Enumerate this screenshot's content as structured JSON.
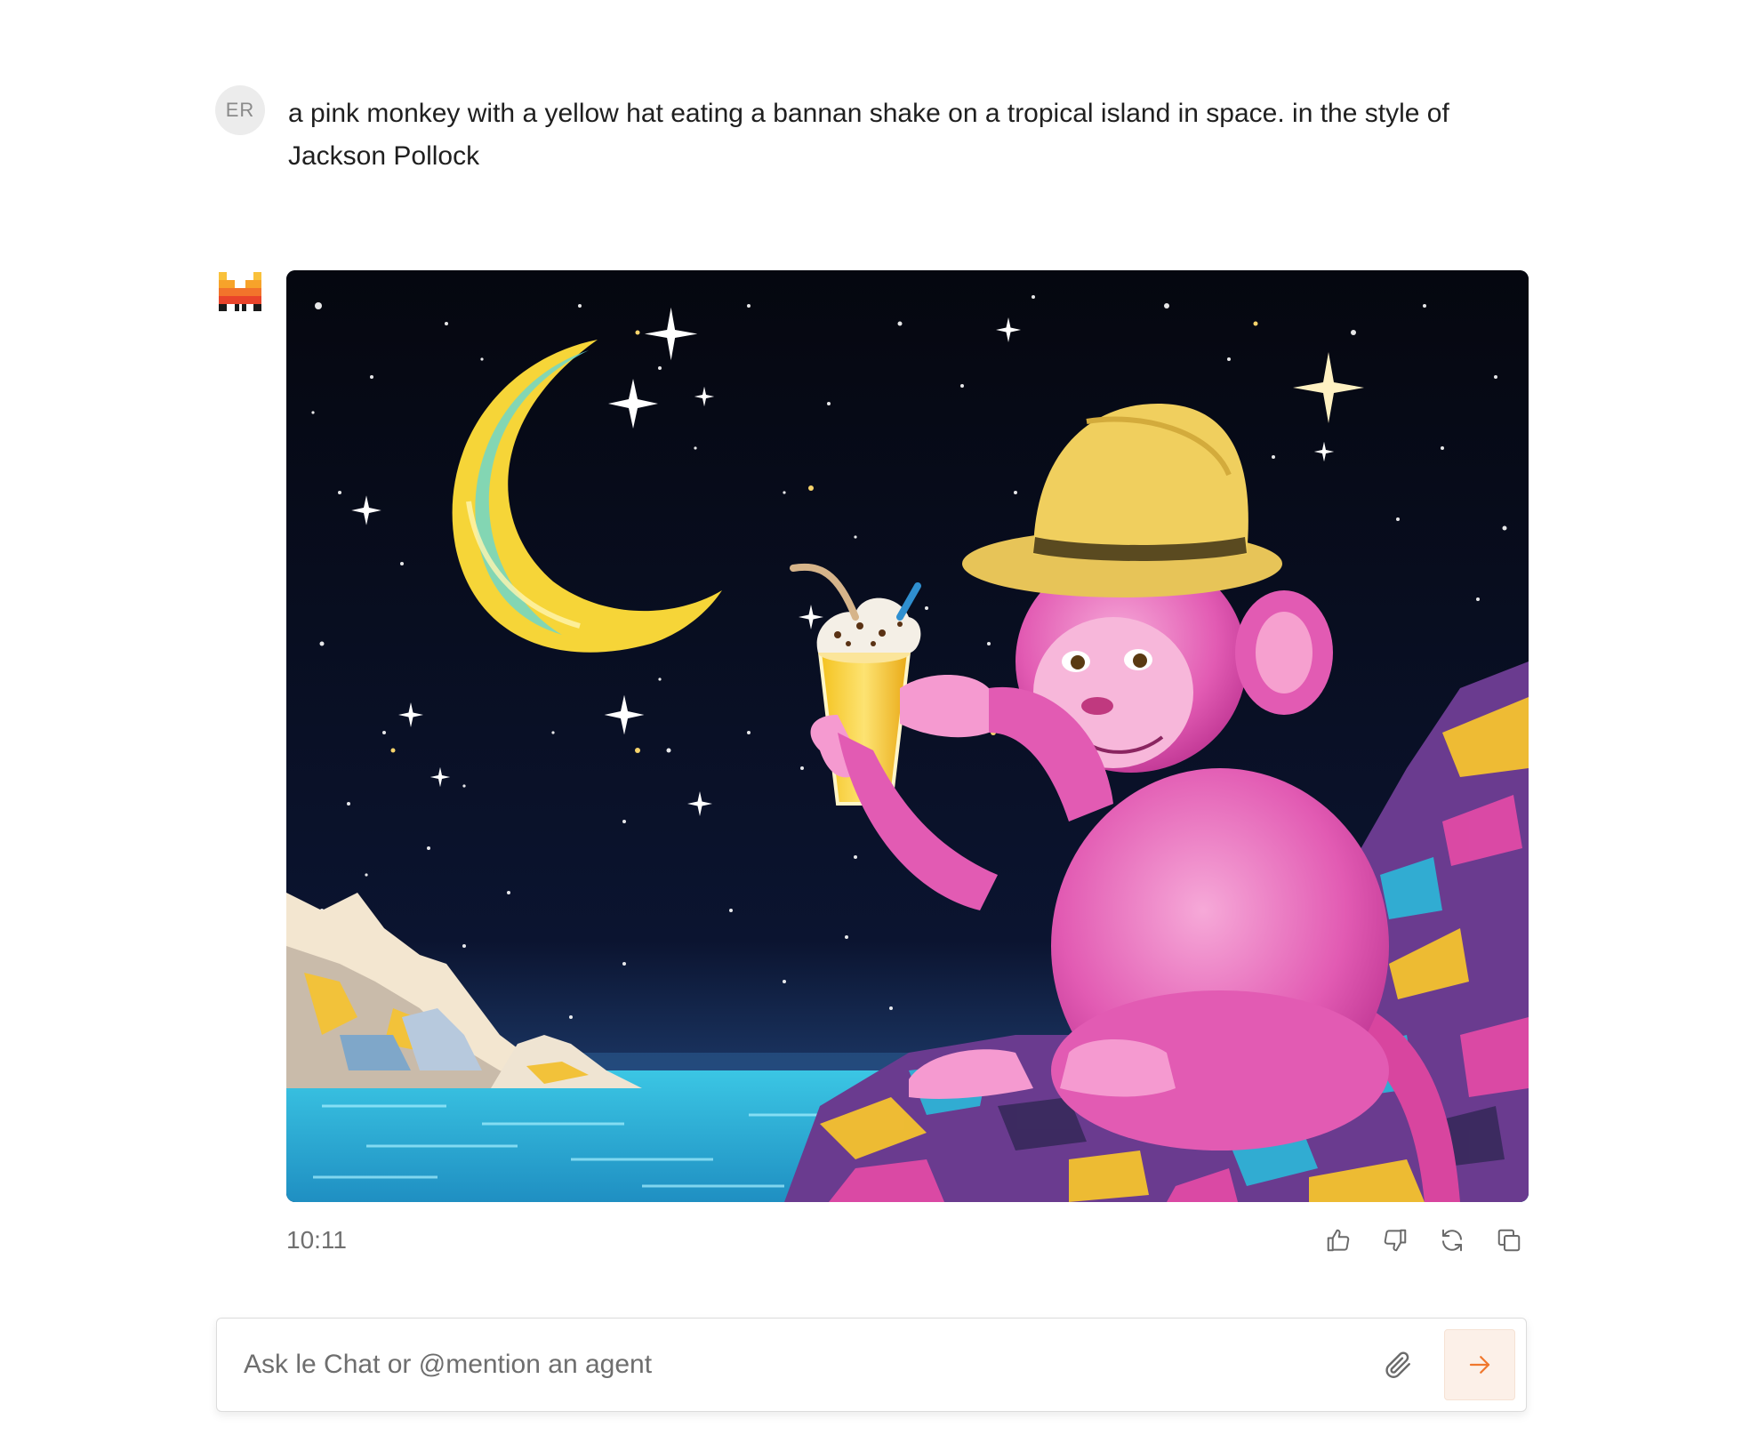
{
  "user_message": {
    "avatar_initials": "ER",
    "text": "a pink monkey with a yellow hat eating a bannan shake on a tropical island in space. in the style of Jackson Pollock"
  },
  "assistant_message": {
    "logo_icon": "mistral-logo-icon",
    "timestamp": "10:11",
    "actions": [
      "thumbs-up-icon",
      "thumbs-down-icon",
      "regenerate-icon",
      "copy-icon"
    ]
  },
  "composer": {
    "placeholder": "Ask le Chat or @mention an agent",
    "value": "",
    "attach_icon": "paperclip-icon",
    "send_icon": "arrow-right-icon"
  },
  "colors": {
    "accent": "#f0772d",
    "send_bg": "#fcf0e8",
    "icon_gray": "#6a6a6a"
  }
}
